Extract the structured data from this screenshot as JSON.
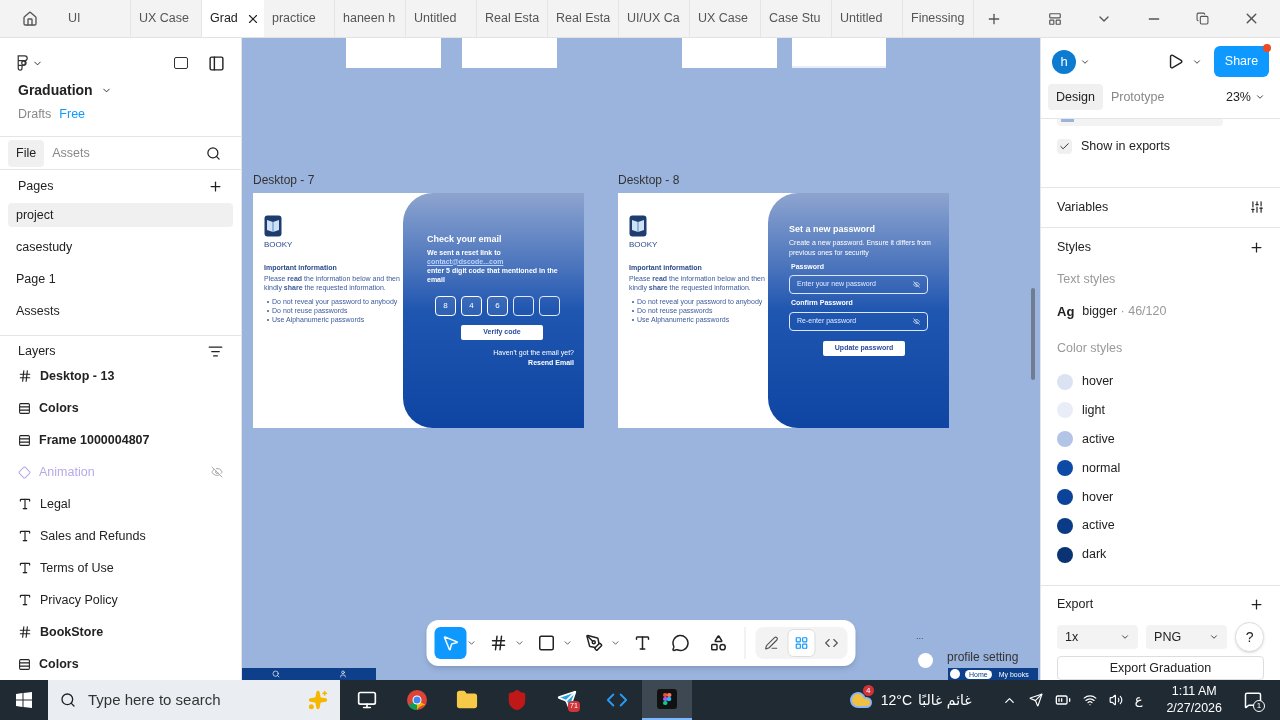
{
  "browser_tabs": [
    {
      "label": "UI",
      "selected": false
    },
    {
      "label": "UX Case",
      "selected": false
    },
    {
      "label": "Grad",
      "selected": true
    },
    {
      "label": "practice",
      "selected": false
    },
    {
      "label": "haneen h",
      "selected": false
    },
    {
      "label": "Untitled",
      "selected": false
    },
    {
      "label": "Real Esta",
      "selected": false
    },
    {
      "label": "Real Esta",
      "selected": false
    },
    {
      "label": "UI/UX Ca",
      "selected": false
    },
    {
      "label": "UX Case",
      "selected": false
    },
    {
      "label": "Case Stu",
      "selected": false
    },
    {
      "label": "Untitled",
      "selected": false
    },
    {
      "label": "Finessing",
      "selected": false
    }
  ],
  "left_panel": {
    "file_name": "Graduation",
    "location": "Drafts",
    "plan": "Free",
    "tabs": [
      {
        "label": "File",
        "selected": true
      },
      {
        "label": "Assets",
        "selected": false
      }
    ],
    "pages_heading": "Pages",
    "pages": [
      {
        "label": "project",
        "selected": true
      },
      {
        "label": "casestudy",
        "selected": false
      },
      {
        "label": "Page 1",
        "selected": false
      },
      {
        "label": "Assests",
        "selected": false
      }
    ],
    "layers_heading": "Layers",
    "layers": [
      {
        "label": "Desktop - 13",
        "kind": "frame",
        "hidden": false
      },
      {
        "label": "Colors",
        "kind": "section",
        "hidden": false
      },
      {
        "label": "Frame 1000004807",
        "kind": "section",
        "hidden": false
      },
      {
        "label": "Animation",
        "kind": "component",
        "hidden": true
      },
      {
        "label": "Legal",
        "kind": "text",
        "hidden": false
      },
      {
        "label": "Sales and Refunds",
        "kind": "text",
        "hidden": false
      },
      {
        "label": "Terms of Use",
        "kind": "text",
        "hidden": false
      },
      {
        "label": "Privacy Policy",
        "kind": "text",
        "hidden": false
      },
      {
        "label": "BookStore",
        "kind": "frame",
        "hidden": false
      },
      {
        "label": "Colors",
        "kind": "section",
        "hidden": false
      }
    ]
  },
  "canvas": {
    "frames": [
      {
        "label": "Desktop - 7",
        "kind": "verify",
        "logo_text": "BOOKY",
        "info_title": "Important information",
        "info_text": "Please **read** the information below and then kindly **share** the requested information.",
        "bullets": [
          "Do not reveal your password to anybody",
          "Do not reuse passwords",
          "Use Alphanumeric passwords"
        ],
        "title": "Check your email",
        "message": "We sent a reset link to",
        "link": "contact@dscode...com",
        "message_2": "enter 5 digit code that mentioned in the email",
        "code_boxes": [
          {
            "filled": true,
            "digit": "8"
          },
          {
            "filled": true,
            "digit": "4"
          },
          {
            "filled": true,
            "digit": "6"
          },
          {
            "filled": false
          },
          {
            "filled": false
          }
        ],
        "button": "Verify code",
        "footer_question": "Haven't got the email yet?",
        "footer_link": "Resend Email"
      },
      {
        "label": "Desktop - 8",
        "kind": "password",
        "logo_text": "BOOKY",
        "info_title": "Important information",
        "info_text": "Please **read** the information below and then kindly **share** the requested information.",
        "bullets": [
          "Do not reveal your password to anybody",
          "Do not reuse passwords",
          "Use Alphanumeric passwords"
        ],
        "title": "Set a new password",
        "message": "Create a new password. Ensure it differs from previous ones for security",
        "fields": [
          {
            "label": "Password",
            "placeholder": "Enter your new password"
          },
          {
            "label": "Confirm Password",
            "placeholder": "Re-enter password"
          }
        ],
        "button": "Update password"
      }
    ],
    "bottom_right": {
      "more": "...",
      "label": "profile setting",
      "nav": [
        "Home",
        "My books"
      ]
    }
  },
  "toolbar": {
    "tools": [
      {
        "kind": "move",
        "selected": true,
        "menu": true
      },
      {
        "kind": "frame",
        "selected": false,
        "menu": true
      },
      {
        "kind": "shape",
        "selected": false,
        "menu": true
      },
      {
        "kind": "pen",
        "selected": false,
        "menu": true
      },
      {
        "kind": "text",
        "selected": false,
        "menu": false
      },
      {
        "kind": "comment",
        "selected": false,
        "menu": false
      },
      {
        "kind": "actions",
        "selected": false,
        "menu": false
      }
    ],
    "modes": [
      {
        "kind": "draw",
        "selected": false
      },
      {
        "kind": "design",
        "selected": true
      },
      {
        "kind": "dev",
        "selected": false
      }
    ]
  },
  "right_panel": {
    "avatar": "h",
    "share": "Share",
    "tabs": [
      {
        "label": "Design",
        "selected": true
      },
      {
        "label": "Prototype",
        "selected": false
      }
    ],
    "zoom": "23%",
    "show_in_exports": {
      "label": "Show in exports",
      "checked": true
    },
    "variables": "Variables",
    "styles": "Styles",
    "text_styles_heading": "Text styles",
    "text_styles": [
      {
        "sample": "Ag",
        "name": "bigger",
        "spec": "· 46/120"
      }
    ],
    "color_styles_heading": "Color styles",
    "color_styles": [
      {
        "name": "hover",
        "color": "#dbe3f3"
      },
      {
        "name": "light",
        "color": "#e8edf7"
      },
      {
        "name": "active",
        "color": "#b3c5e6"
      },
      {
        "name": "normal",
        "color": "#0d4aa6"
      },
      {
        "name": "hover",
        "color": "#0c439a"
      },
      {
        "name": "active",
        "color": "#0b3b87"
      },
      {
        "name": "dark",
        "color": "#0a3373"
      }
    ],
    "export": "Export",
    "scale": "1x",
    "format": "PNG",
    "export_button": "Export Graduation",
    "help": "?"
  },
  "taskbar": {
    "search_placeholder": "Type here to search",
    "apps": [
      {
        "kind": "taskview",
        "selected": false
      },
      {
        "kind": "chrome",
        "selected": false
      },
      {
        "kind": "folder",
        "selected": false
      },
      {
        "kind": "shield",
        "selected": false
      },
      {
        "kind": "telegram",
        "selected": false,
        "badge": "71"
      },
      {
        "kind": "code",
        "selected": false
      },
      {
        "kind": "figma",
        "selected": true
      }
    ],
    "weather_badge": "4",
    "temperature": "12°C",
    "weather": "غائم غالبًا",
    "language": "ع",
    "time": "1:11 AM",
    "date": "2/27/2026",
    "notifications": "1"
  }
}
